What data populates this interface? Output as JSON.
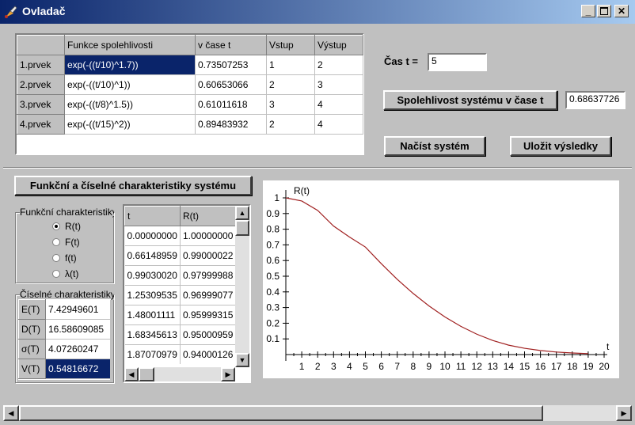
{
  "window": {
    "title": "Ovladač"
  },
  "elements_table": {
    "headers": [
      "",
      "Funkce spolehlivosti",
      "v čase t",
      "Vstup",
      "Výstup"
    ],
    "rows": [
      {
        "name": "1.prvek",
        "func": "exp(-((t/10)^1.7))",
        "value": "0.73507253",
        "input": "1",
        "output": "2"
      },
      {
        "name": "2.prvek",
        "func": "exp(-((t/10)^1))",
        "value": "0.60653066",
        "input": "2",
        "output": "3"
      },
      {
        "name": "3.prvek",
        "func": "exp(-((t/8)^1.5))",
        "value": "0.61011618",
        "input": "3",
        "output": "4"
      },
      {
        "name": "4.prvek",
        "func": "exp(-((t/15)^2))",
        "value": "0.89483932",
        "input": "2",
        "output": "4"
      }
    ]
  },
  "time": {
    "label": "Čas t =",
    "value": "5"
  },
  "reliability": {
    "button_label": "Spolehlivost systému v čase t",
    "value": "0.68637726"
  },
  "buttons": {
    "load": "Načíst systém",
    "save": "Uložit výsledky",
    "characteristics": "Funkční a číselné charakteristiky systému"
  },
  "functional": {
    "label": "Funkční charakteristiky",
    "options": [
      {
        "label": "R(t)",
        "selected": true
      },
      {
        "label": "F(t)",
        "selected": false
      },
      {
        "label": "f(t)",
        "selected": false
      },
      {
        "label": "λ(t)",
        "selected": false
      }
    ]
  },
  "numeric": {
    "label": "Číselné charakteristiky",
    "rows": [
      {
        "name": "E(T)",
        "value": "7.42949601"
      },
      {
        "name": "D(T)",
        "value": "16.58609085"
      },
      {
        "name": "σ(T)",
        "value": "4.07260247"
      },
      {
        "name": "V(T)",
        "value": "0.54816672"
      }
    ]
  },
  "values_table": {
    "headers": [
      "t",
      "R(t)"
    ],
    "rows": [
      [
        "0.00000000",
        "1.00000000"
      ],
      [
        "0.66148959",
        "0.99000022"
      ],
      [
        "0.99030020",
        "0.97999988"
      ],
      [
        "1.25309535",
        "0.96999077"
      ],
      [
        "1.48001111",
        "0.95999315"
      ],
      [
        "1.68345613",
        "0.95000959"
      ],
      [
        "1.87070979",
        "0.94000126"
      ]
    ]
  },
  "chart_data": {
    "type": "line",
    "ylabel": "R(t)",
    "xlabel": "t",
    "xlim": [
      0,
      20
    ],
    "ylim": [
      0,
      1
    ],
    "xticks": [
      "1",
      "2",
      "3",
      "4",
      "5",
      "6",
      "7",
      "8",
      "9",
      "10",
      "11",
      "12",
      "13",
      "14",
      "15",
      "16",
      "17",
      "18",
      "19",
      "20"
    ],
    "yticks": [
      "0.1",
      "0.2",
      "0.3",
      "0.4",
      "0.5",
      "0.6",
      "0.7",
      "0.8",
      "0.9",
      "1"
    ],
    "color": "#a02020",
    "series": [
      {
        "x": [
          0,
          1,
          2,
          3,
          4,
          5,
          6,
          7,
          8,
          9,
          10,
          11,
          12,
          13,
          14,
          15,
          16,
          17,
          18,
          19
        ],
        "values": [
          1.0,
          0.98,
          0.92,
          0.82,
          0.75,
          0.686,
          0.58,
          0.48,
          0.39,
          0.31,
          0.24,
          0.18,
          0.13,
          0.09,
          0.06,
          0.04,
          0.026,
          0.016,
          0.01,
          0.006
        ]
      }
    ]
  },
  "colors": {
    "title_bar": "#0a246a",
    "selection": "#0a246a",
    "face": "#c0c0c0"
  }
}
